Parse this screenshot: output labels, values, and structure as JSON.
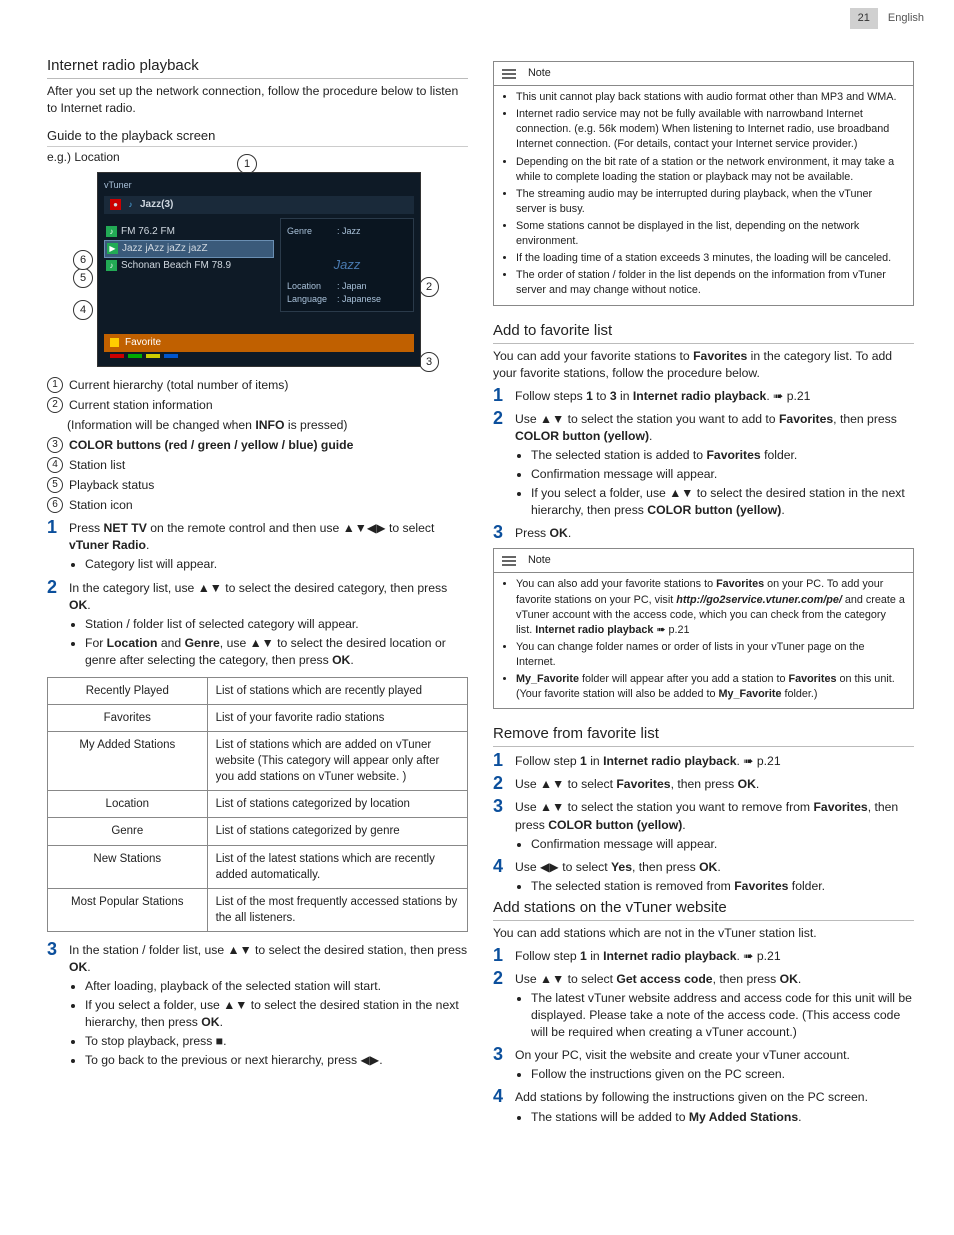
{
  "header": {
    "page": "21",
    "lang": "English"
  },
  "left": {
    "h2": "Internet radio playback",
    "intro": "After you set up the network connection, follow the procedure below to listen to Internet radio.",
    "h3": "Guide to the playback screen",
    "eg": "e.g.) Location",
    "tv": {
      "brand": "vTuner",
      "jazz": "Jazz(3)",
      "r1": "FM 76.2 FM",
      "r2": "Jazz jAzz jaZz jazZ",
      "r3": "Schonan Beach FM 78.9",
      "genre_l": "Genre",
      "genre_v": ": Jazz",
      "jazz_word": "Jazz",
      "loc_l": "Location",
      "loc_v": ": Japan",
      "lang_l": "Language",
      "lang_v": ": Japanese",
      "fav": "Favorite"
    },
    "legend": [
      "Current hierarchy (total number of items)",
      "Current station information",
      "COLOR buttons (red / green / yellow / blue) guide",
      "Station list",
      "Playback status",
      "Station icon"
    ],
    "legend2_extra_pre": "(Information will be changed when ",
    "legend2_extra_bold": "INFO",
    "legend2_extra_post": " is pressed)",
    "step1_a": "Press ",
    "step1_b": "NET TV",
    "step1_c": " on the remote control and then use ▲▼◀▶ to select ",
    "step1_d": "vTuner Radio",
    "step1_e": ".",
    "step1_bul": "Category list will appear.",
    "step2_a": "In the category list, use ▲▼ to select the desired category, then press ",
    "step2_b": "OK",
    "step2_c": ".",
    "step2_bul1": "Station / folder list of selected category will appear.",
    "step2_bul2_a": "For ",
    "step2_bul2_b": "Location",
    "step2_bul2_c": " and ",
    "step2_bul2_d": "Genre",
    "step2_bul2_e": ", use ▲▼ to select the desired location or genre after selecting the category, then press ",
    "step2_bul2_f": "OK",
    "step2_bul2_g": ".",
    "table": [
      [
        "Recently Played",
        "List of stations which are recently played"
      ],
      [
        "Favorites",
        "List of your favorite radio stations"
      ],
      [
        "My Added Stations",
        "List of stations which are added on vTuner website (This category will appear only after you add stations on vTuner website. )"
      ],
      [
        "Location",
        "List of stations categorized by location"
      ],
      [
        "Genre",
        "List of stations categorized by genre"
      ],
      [
        "New Stations",
        "List of the latest stations which are recently added automatically."
      ],
      [
        "Most Popular Stations",
        "List of the most frequently accessed stations by the all listeners."
      ]
    ],
    "step3_a": "In the station / folder list, use ▲▼ to select the desired station, then press ",
    "step3_b": "OK",
    "step3_c": ".",
    "step3_bul1": "After loading, playback of the selected station will start.",
    "step3_bul2_a": "If you select a folder, use ▲▼ to select the desired station in the next hierarchy, then press ",
    "step3_bul2_b": "OK",
    "step3_bul2_c": ".",
    "step3_bul3": "To stop playback, press ■.",
    "step3_bul4": "To go back to the previous or next hierarchy, press ◀▶."
  },
  "right": {
    "note1_title": "Note",
    "note1": [
      "This unit cannot play back stations with audio format other than MP3 and WMA.",
      "Internet radio service may not be fully available with narrowband Internet connection. (e.g. 56k modem) When listening to Internet radio, use broadband Internet connection. (For details, contact your Internet service provider.)",
      "Depending on the bit rate of a station or the network environment, it may take a while to complete loading the station or playback may not be available.",
      "The streaming audio may be interrupted during playback, when the vTuner server is busy.",
      "Some stations cannot be displayed in the list, depending on the network environment.",
      "If the loading time of a station exceeds 3 minutes, the loading will be canceled.",
      "The order of station / folder in the list depends on the information from vTuner server and may change without notice."
    ],
    "addfav_h": "Add to favorite list",
    "addfav_p_a": "You can add your favorite stations to ",
    "addfav_p_b": "Favorites",
    "addfav_p_c": " in the category list. To add your favorite stations, follow the procedure below.",
    "addfav_s1_a": "Follow steps ",
    "addfav_s1_b": "1",
    "addfav_s1_c": " to ",
    "addfav_s1_d": "3",
    "addfav_s1_e": " in ",
    "addfav_s1_f": "Internet radio playback",
    "addfav_s1_g": ". ➠ p.21",
    "addfav_s2_a": "Use ▲▼ to select the station you want to add to ",
    "addfav_s2_b": "Favorites",
    "addfav_s2_c": ", then press ",
    "addfav_s2_d": "COLOR button (yellow)",
    "addfav_s2_e": ".",
    "addfav_s2_b1_a": "The selected station is added to ",
    "addfav_s2_b1_b": "Favorites",
    "addfav_s2_b1_c": " folder.",
    "addfav_s2_b2": "Confirmation message will appear.",
    "addfav_s2_b3_a": "If you select a folder, use ▲▼ to select the desired station in the next hierarchy, then press ",
    "addfav_s2_b3_b": "COLOR button (yellow)",
    "addfav_s2_b3_c": ".",
    "addfav_s3_a": "Press ",
    "addfav_s3_b": "OK",
    "addfav_s3_c": ".",
    "note2_title": "Note",
    "note2_1_a": "You can also add your favorite stations to ",
    "note2_1_b": "Favorites",
    "note2_1_c": " on your PC. To add your favorite stations on your PC, visit ",
    "note2_1_d": "http://go2service.vtuner.com/pe/",
    "note2_1_e": " and create a vTuner account with the access code, which you can check from the category list. ",
    "note2_1_f": "Internet radio playback",
    "note2_1_g": " ➠ p.21",
    "note2_2": "You can change folder names or order of lists in your vTuner page on the Internet.",
    "note2_3_a": "My_Favorite",
    "note2_3_b": " folder will appear after you add a station to ",
    "note2_3_c": "Favorites",
    "note2_3_d": " on this unit. (Your favorite station will also be added to ",
    "note2_3_e": "My_Favorite",
    "note2_3_f": " folder.)",
    "remfav_h": "Remove from favorite list",
    "remfav_s1_a": "Follow step ",
    "remfav_s1_b": "1",
    "remfav_s1_c": " in ",
    "remfav_s1_d": "Internet radio playback",
    "remfav_s1_e": ". ➠ p.21",
    "remfav_s2_a": "Use ▲▼ to select ",
    "remfav_s2_b": "Favorites",
    "remfav_s2_c": ", then press ",
    "remfav_s2_d": "OK",
    "remfav_s2_e": ".",
    "remfav_s3_a": "Use ▲▼ to select the station you want to remove from ",
    "remfav_s3_b": "Favorites",
    "remfav_s3_c": ", then press ",
    "remfav_s3_d": "COLOR button (yellow)",
    "remfav_s3_e": ".",
    "remfav_s3_b1": "Confirmation message will appear.",
    "remfav_s4_a": "Use ◀▶ to select ",
    "remfav_s4_b": "Yes",
    "remfav_s4_c": ", then press ",
    "remfav_s4_d": "OK",
    "remfav_s4_e": ".",
    "remfav_s4_b1_a": "The selected station is removed from ",
    "remfav_s4_b1_b": "Favorites",
    "remfav_s4_b1_c": " folder.",
    "addvt_h": "Add stations on the vTuner website",
    "addvt_p": "You can add stations which are not in the vTuner station list.",
    "addvt_s1_a": "Follow step ",
    "addvt_s1_b": "1",
    "addvt_s1_c": " in ",
    "addvt_s1_d": "Internet radio playback",
    "addvt_s1_e": ". ➠ p.21",
    "addvt_s2_a": "Use ▲▼ to select ",
    "addvt_s2_b": "Get access code",
    "addvt_s2_c": ", then press ",
    "addvt_s2_d": "OK",
    "addvt_s2_e": ".",
    "addvt_s2_b1": "The latest vTuner website address and access code for this unit will be displayed. Please take a note of the access code. (This access code will be required when creating a vTuner account.)",
    "addvt_s3": "On your PC, visit the website and create your vTuner account.",
    "addvt_s3_b1": "Follow the instructions given on the PC screen.",
    "addvt_s4": "Add stations by following the instructions given on the PC screen.",
    "addvt_s4_b1_a": "The stations will be added to ",
    "addvt_s4_b1_b": "My Added Stations",
    "addvt_s4_b1_c": "."
  }
}
